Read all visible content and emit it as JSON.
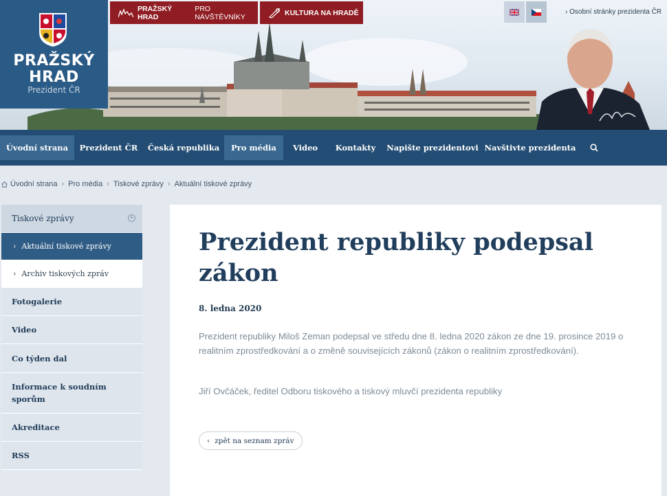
{
  "header": {
    "logo": {
      "name": "PRAŽSKÝ HRAD",
      "subtitle": "Prezident ČR"
    },
    "top_tabs": [
      {
        "bold": "PRAŽSKÝ HRAD",
        "light": "PRO NÁVŠTĚVNÍKY"
      },
      {
        "bold": "KULTURA NA HRADĚ",
        "light": ""
      }
    ],
    "languages": [
      "English",
      "Čeština"
    ],
    "personal_link": "› Osobní stránky prezidenta ČR"
  },
  "nav": {
    "items": [
      {
        "label": "Úvodní strana",
        "active": true
      },
      {
        "label": "Prezident ČR",
        "active": false
      },
      {
        "label": "Česká republika",
        "active": false
      },
      {
        "label": "Pro média",
        "active": true
      },
      {
        "label": "Video",
        "active": false
      },
      {
        "label": "Kontakty",
        "active": false
      },
      {
        "label": "Napište prezidentovi",
        "active": false
      },
      {
        "label": "Navštivte prezidenta",
        "active": false
      }
    ],
    "search_icon": "search-icon"
  },
  "breadcrumb": [
    "Úvodní strana",
    "Pro média",
    "Tiskové zprávy",
    "Aktuální tiskové zprávy"
  ],
  "sidebar": {
    "section": "Tiskové zprávy",
    "subitems": [
      {
        "label": "Aktuální tiskové zprávy",
        "active": true
      },
      {
        "label": "Archiv tiskových zpráv",
        "active": false
      }
    ],
    "items": [
      "Fotogalerie",
      "Video",
      "Co týden dal",
      "Informace k soudním sporům",
      "Akreditace",
      "RSS"
    ]
  },
  "article": {
    "title": "Prezident republiky podepsal zákon",
    "date": "8. ledna 2020",
    "paragraphs": [
      "Prezident republiky Miloš Zeman podepsal ve středu dne 8. ledna 2020 zákon ze dne 19. prosince 2019 o realitním zprostředkování a o změně souvisejících zákonů (zákon o realitním zprostředkování).",
      "Jiří Ovčáček, ředitel Odboru tiskového a tiskový mluvčí prezidenta republiky"
    ],
    "back_label": "zpět na seznam zpráv"
  },
  "colors": {
    "brand_blue": "#234d74",
    "active_blue": "#3a6891",
    "brand_red": "#8f1d23",
    "title_color": "#213e5c"
  }
}
